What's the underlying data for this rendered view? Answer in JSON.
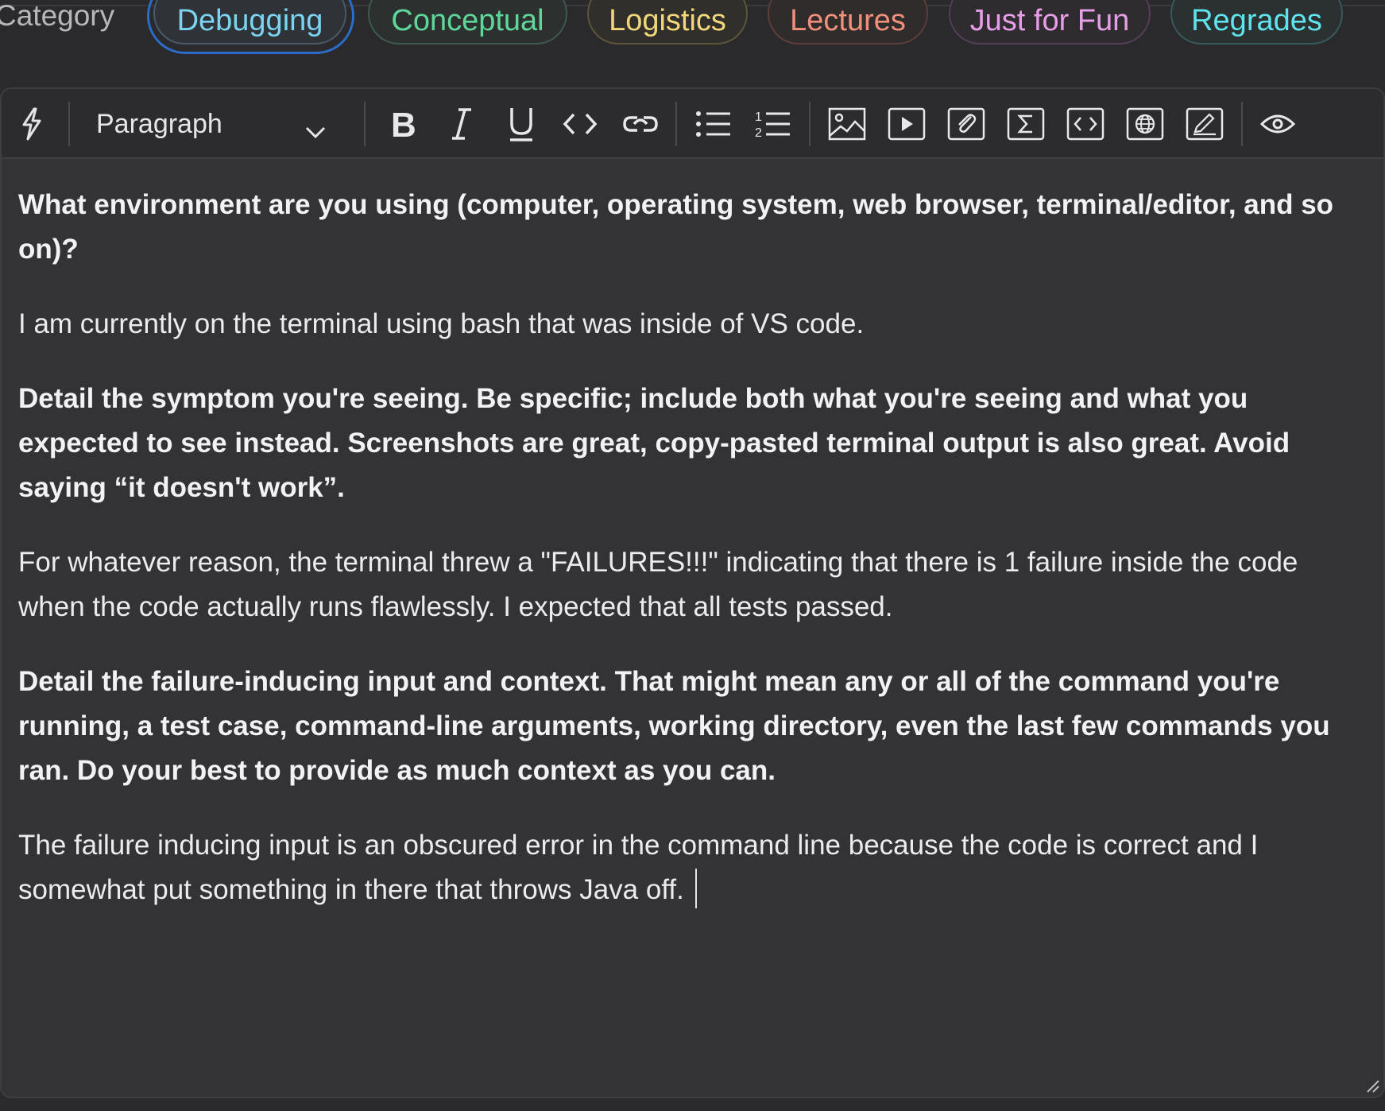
{
  "category": {
    "label": "Category",
    "chips": [
      {
        "label": "Debugging",
        "color": "#7ad3f0",
        "selected": true
      },
      {
        "label": "Conceptual",
        "color": "#5fd69a",
        "selected": false
      },
      {
        "label": "Logistics",
        "color": "#f2d67a",
        "selected": false
      },
      {
        "label": "Lectures",
        "color": "#f0907a",
        "selected": false
      },
      {
        "label": "Just for Fun",
        "color": "#e79ee8",
        "selected": false
      },
      {
        "label": "Regrades",
        "color": "#5fe3ec",
        "selected": false
      }
    ]
  },
  "toolbar": {
    "block_style": "Paragraph",
    "icons": [
      "lightning-icon",
      "bold-icon",
      "italic-icon",
      "underline-icon",
      "inline-code-icon",
      "link-icon",
      "bullet-list-icon",
      "numbered-list-icon",
      "image-icon",
      "video-icon",
      "attachment-icon",
      "math-icon",
      "code-block-icon",
      "embed-web-icon",
      "drawing-icon",
      "preview-icon"
    ]
  },
  "body": {
    "q1": "What environment are you using (computer, operating system, web browser, terminal/editor, and so on)?",
    "a1": "I am currently on the terminal using bash that was inside of VS code.",
    "q2": "Detail the symptom you're seeing. Be specific; include both what you're seeing and what you expected to see instead. Screenshots are great, copy-pasted terminal output is also great. Avoid saying “it doesn't work”.",
    "a2": "For whatever reason, the terminal threw a \"FAILURES!!!\" indicating that there is 1 failure inside the code when the code actually runs flawlessly. I expected that all tests passed.",
    "q3": "Detail the failure-inducing input and context. That might mean any or all of the command you're running, a test case, command-line arguments, working directory, even the last few commands you ran. Do your best to provide as much context as you can.",
    "a3": "The failure inducing input is an obscured error in the command line because the code is correct and I somewhat put something in there that throws Java off."
  }
}
